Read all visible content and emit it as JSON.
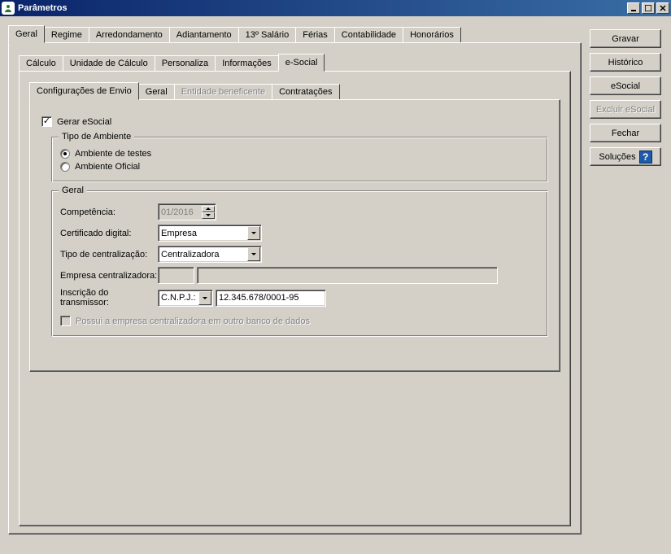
{
  "window": {
    "title": "Parâmetros"
  },
  "tabs_level1": {
    "items": [
      "Geral",
      "Regime",
      "Arredondamento",
      "Adiantamento",
      "13º Salário",
      "Férias",
      "Contabilidade",
      "Honorários"
    ],
    "active_index": 0
  },
  "tabs_level2": {
    "items": [
      "Cálculo",
      "Unidade de Cálculo",
      "Personaliza",
      "Informações",
      "e-Social"
    ],
    "active_index": 4
  },
  "tabs_level3": {
    "items": [
      "Configurações de Envio",
      "Geral",
      "Entidade beneficente",
      "Contratações"
    ],
    "disabled_index": 2,
    "active_index": 0
  },
  "esocial": {
    "gerar_label": "Gerar eSocial",
    "gerar_checked": true,
    "ambiente": {
      "legend": "Tipo de Ambiente",
      "options": [
        "Ambiente de testes",
        "Ambiente Oficial"
      ],
      "selected_index": 0
    },
    "geral": {
      "legend": "Geral",
      "competencia_label": "Competência:",
      "competencia_value": "01/2016",
      "certificado_label": "Certificado digital:",
      "certificado_value": "Empresa",
      "centralizacao_label": "Tipo de centralização:",
      "centralizacao_value": "Centralizadora",
      "empresa_centralizadora_label": "Empresa centralizadora:",
      "empresa_centralizadora_code": "",
      "empresa_centralizadora_name": "",
      "inscricao_label": "Inscrição do transmissor:",
      "inscricao_tipo": "C.N.P.J.:",
      "inscricao_value": "12.345.678/0001-95",
      "possui_centralizadora_label": "Possui a empresa centralizadora em outro banco de dados",
      "possui_centralizadora_checked": false
    }
  },
  "buttons": {
    "gravar": "Gravar",
    "historico": "Histórico",
    "esocial": "eSocial",
    "excluir": "Excluir eSocial",
    "fechar": "Fechar",
    "solucoes": "Soluções"
  }
}
